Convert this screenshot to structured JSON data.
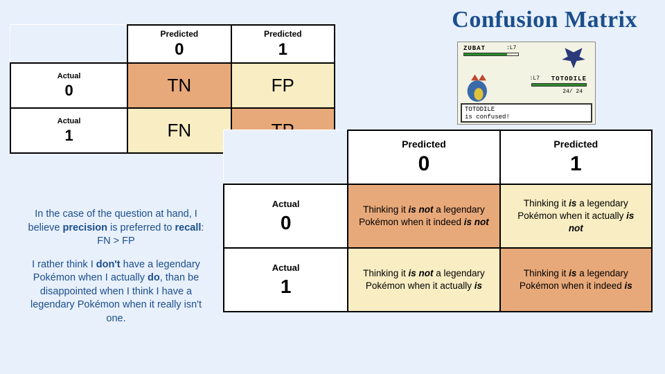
{
  "title": "Confusion Matrix",
  "small_matrix": {
    "pred_label": "Predicted",
    "act_label": "Actual",
    "pred_vals": [
      "0",
      "1"
    ],
    "act_vals": [
      "0",
      "1"
    ],
    "cells": {
      "tn": "TN",
      "fp": "FP",
      "fn": "FN",
      "tp": "TP"
    }
  },
  "big_matrix": {
    "pred_label": "Predicted",
    "act_label": "Actual",
    "pred_vals": [
      "0",
      "1"
    ],
    "act_vals": [
      "0",
      "1"
    ],
    "cells": {
      "tn_pre": "Thinking it ",
      "tn_b1": "is not",
      "tn_mid": " a legendary Pokémon when it indeed ",
      "tn_b2": "is not",
      "fp_pre": "Thinking it ",
      "fp_b1": "is",
      "fp_mid": " a legendary Pokémon when it actually ",
      "fp_b2": "is not",
      "fn_pre": "Thinking it ",
      "fn_b1": "is not",
      "fn_mid": " a legendary Pokémon when it actually ",
      "fn_b2": "is",
      "tp_pre": "Thinking it ",
      "tp_b1": "is",
      "tp_mid": " a legendary Pokémon when it indeed ",
      "tp_b2": "is"
    }
  },
  "explain": {
    "p1_pre": "In the case of the question at hand, I believe ",
    "p1_b1": "precision",
    "p1_mid": " is preferred to ",
    "p1_b2": "recall",
    "p1_post": ": FN > FP",
    "p2_pre": "I rather think I ",
    "p2_b1": "don't",
    "p2_mid": " have a legendary Pokémon when I actually ",
    "p2_b2": "do",
    "p2_post": ", than be disappointed when I think I have a legendary Pokémon when it really isn't one."
  },
  "battle": {
    "enemy_name": "ZUBAT",
    "enemy_lv": ":L7",
    "own_name": "TOTODILE",
    "own_lv": ":L7",
    "own_hp": "24/ 24",
    "msg_line1": "TOTODILE",
    "msg_line2": "is confused!"
  }
}
